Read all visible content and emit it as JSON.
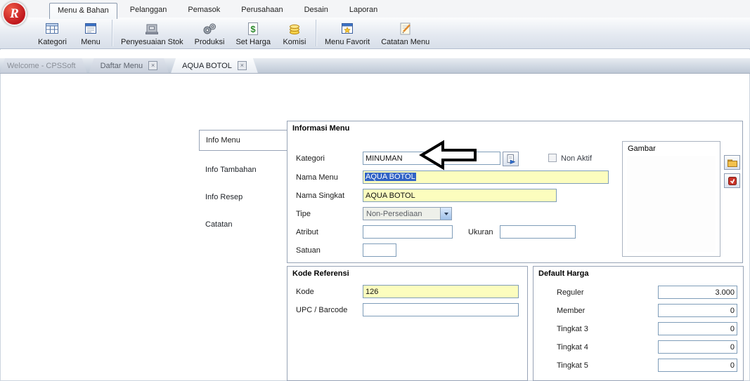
{
  "window": {
    "menu_tabs": [
      {
        "label": "Menu & Bahan",
        "active": true
      },
      {
        "label": "Pelanggan",
        "active": false
      },
      {
        "label": "Pemasok",
        "active": false
      },
      {
        "label": "Perusahaan",
        "active": false
      },
      {
        "label": "Desain",
        "active": false
      },
      {
        "label": "Laporan",
        "active": false
      }
    ]
  },
  "toolbar": {
    "items": [
      {
        "label": "Kategori",
        "icon": "categories-grid-icon"
      },
      {
        "label": "Menu",
        "icon": "menu-window-icon"
      },
      {
        "label": "Penyesuaian Stok",
        "icon": "stock-adjustment-icon"
      },
      {
        "label": "Produksi",
        "icon": "production-gears-icon"
      },
      {
        "label": "Set Harga",
        "icon": "set-price-icon"
      },
      {
        "label": "Komisi",
        "icon": "commission-coins-icon"
      },
      {
        "label": "Menu Favorit",
        "icon": "favorite-menu-icon"
      },
      {
        "label": "Catatan Menu",
        "icon": "menu-notes-icon"
      }
    ]
  },
  "document_tabs": [
    {
      "label": "Welcome - CPSSoft",
      "active": false,
      "closable": false
    },
    {
      "label": "Daftar Menu",
      "active": false,
      "closable": true
    },
    {
      "label": "AQUA BOTOL",
      "active": true,
      "closable": true
    }
  ],
  "sidebar": {
    "items": [
      {
        "label": "Info Menu",
        "active": true
      },
      {
        "label": "Info Tambahan",
        "active": false
      },
      {
        "label": "Info Resep",
        "active": false
      },
      {
        "label": "Catatan",
        "active": false
      }
    ]
  },
  "form": {
    "informasi_menu": {
      "title": "Informasi Menu",
      "kategori_label": "Kategori",
      "kategori_value": "MINUMAN",
      "non_aktif_label": "Non Aktif",
      "non_aktif_checked": false,
      "nama_menu_label": "Nama Menu",
      "nama_menu_value": "AQUA BOTOL",
      "nama_singkat_label": "Nama Singkat",
      "nama_singkat_value": "AQUA BOTOL",
      "tipe_label": "Tipe",
      "tipe_value": "Non-Persediaan",
      "atribut_label": "Atribut",
      "atribut_value": "",
      "ukuran_label": "Ukuran",
      "ukuran_value": "",
      "satuan_label": "Satuan",
      "satuan_value": "",
      "gambar_title": "Gambar"
    },
    "kode_referensi": {
      "title": "Kode Referensi",
      "kode_label": "Kode",
      "kode_value": "126",
      "upc_label": "UPC / Barcode",
      "upc_value": ""
    },
    "default_harga": {
      "title": "Default Harga",
      "rows": [
        {
          "label": "Reguler",
          "value": "3.000"
        },
        {
          "label": "Member",
          "value": "0"
        },
        {
          "label": "Tingkat 3",
          "value": "0"
        },
        {
          "label": "Tingkat 4",
          "value": "0"
        },
        {
          "label": "Tingkat 5",
          "value": "0"
        }
      ]
    }
  },
  "icons": {
    "close": "×",
    "logo_letter": "R"
  },
  "colors": {
    "required_field_bg": "#fcfdbe",
    "selection_bg": "#3163c5",
    "logo_red": "#c0181d"
  }
}
